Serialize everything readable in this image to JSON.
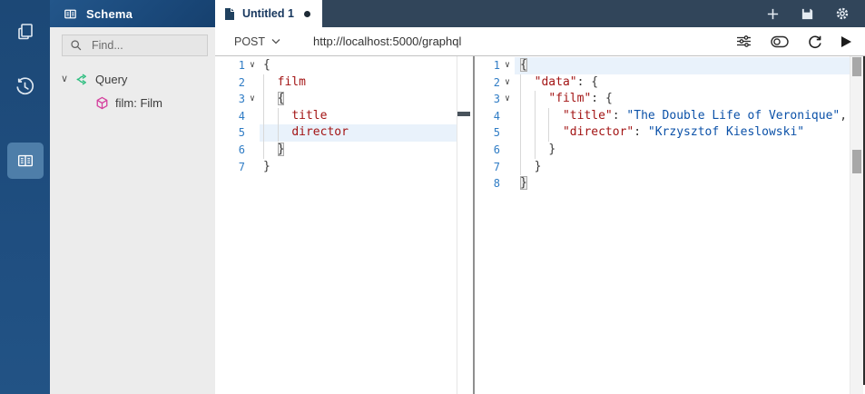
{
  "activity_bar": {
    "items": [
      {
        "id": "collections",
        "icon": "pages-icon",
        "selected": false
      },
      {
        "id": "history",
        "icon": "history-icon",
        "selected": false
      },
      {
        "id": "schema-docs",
        "icon": "book-icon",
        "selected": true
      }
    ]
  },
  "sidebar": {
    "title": "Schema",
    "search_placeholder": "Find...",
    "tree": {
      "root": {
        "label": "Query",
        "icon": "query-type-icon",
        "expanded": true
      },
      "child": {
        "label": "film: Film",
        "icon": "object-type-icon"
      }
    }
  },
  "tabbar": {
    "active_tab": {
      "label": "Untitled 1",
      "modified": true
    },
    "actions": [
      "new-tab",
      "save",
      "settings"
    ]
  },
  "request_bar": {
    "method": "POST",
    "url": "http://localhost:5000/graphql",
    "actions": [
      "request-options",
      "toggle-variables",
      "refresh",
      "run"
    ]
  },
  "colors": {
    "activity_bar_bg": "#1f4e80",
    "sidebar_header_bg": "#1b4a7c",
    "tabbar_bg": "#31455a",
    "selected_item_bg": "#4e7ea9",
    "line_number": "#2f7cc5",
    "token_red": "#a31515",
    "token_blue": "#0b51a8",
    "token_punct": "#383838",
    "current_line_bg": "#e9f2fb",
    "query_icon_green": "#2bbd7e",
    "object_icon_pink": "#d5409e"
  },
  "editors": {
    "query": {
      "lines": [
        {
          "n": 1,
          "fold": true,
          "tokens": [
            [
              "{",
              "p"
            ]
          ]
        },
        {
          "n": 2,
          "tokens": [
            [
              "  ",
              "w"
            ],
            [
              "film",
              "r"
            ]
          ]
        },
        {
          "n": 3,
          "fold": true,
          "tokens": [
            [
              "  ",
              "w"
            ],
            [
              "{",
              "pb"
            ]
          ]
        },
        {
          "n": 4,
          "tokens": [
            [
              "    ",
              "w"
            ],
            [
              "title",
              "r"
            ]
          ]
        },
        {
          "n": 5,
          "active": true,
          "tokens": [
            [
              "    ",
              "w"
            ],
            [
              "director",
              "r"
            ]
          ]
        },
        {
          "n": 6,
          "tokens": [
            [
              "  ",
              "w"
            ],
            [
              "}",
              "pb"
            ]
          ]
        },
        {
          "n": 7,
          "tokens": [
            [
              "}",
              "p"
            ]
          ]
        }
      ]
    },
    "response": {
      "lines": [
        {
          "n": 1,
          "fold": true,
          "active": true,
          "tokens": [
            [
              "{",
              "pb"
            ]
          ]
        },
        {
          "n": 2,
          "fold": true,
          "tokens": [
            [
              "  ",
              "w"
            ],
            [
              "\"data\"",
              "r"
            ],
            [
              ": ",
              "p"
            ],
            [
              "{",
              "p"
            ]
          ]
        },
        {
          "n": 3,
          "fold": true,
          "tokens": [
            [
              "    ",
              "w"
            ],
            [
              "\"film\"",
              "r"
            ],
            [
              ": ",
              "p"
            ],
            [
              "{",
              "p"
            ]
          ]
        },
        {
          "n": 4,
          "tokens": [
            [
              "      ",
              "w"
            ],
            [
              "\"title\"",
              "r"
            ],
            [
              ": ",
              "p"
            ],
            [
              "\"The Double Life of Veronique\"",
              "s"
            ],
            [
              ",",
              "p"
            ]
          ]
        },
        {
          "n": 5,
          "tokens": [
            [
              "      ",
              "w"
            ],
            [
              "\"director\"",
              "r"
            ],
            [
              ": ",
              "p"
            ],
            [
              "\"Krzysztof Kieslowski\"",
              "s"
            ]
          ]
        },
        {
          "n": 6,
          "tokens": [
            [
              "    ",
              "w"
            ],
            [
              "}",
              "p"
            ]
          ]
        },
        {
          "n": 7,
          "tokens": [
            [
              "  ",
              "w"
            ],
            [
              "}",
              "p"
            ]
          ]
        },
        {
          "n": 8,
          "tokens": [
            [
              "}",
              "pb"
            ]
          ]
        }
      ]
    }
  }
}
